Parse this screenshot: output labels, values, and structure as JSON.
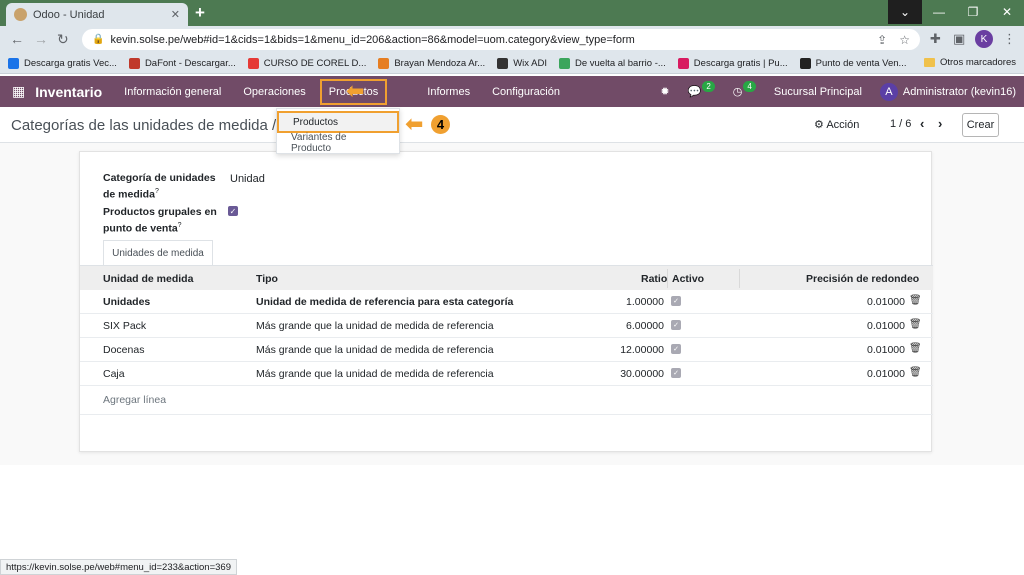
{
  "browser": {
    "tab_title": "Odoo - Unidad",
    "url": "kevin.solse.pe/web#id=1&cids=1&bids=1&menu_id=206&action=86&model=uom.category&view_type=form",
    "profile_initial": "K",
    "bookmarks": [
      {
        "label": "Descarga gratis Vec...",
        "color": "#1a73e8"
      },
      {
        "label": "DaFont - Descargar...",
        "color": "#c0392b"
      },
      {
        "label": "CURSO DE COREL D...",
        "color": "#e53935"
      },
      {
        "label": "Brayan Mendoza Ar...",
        "color": "#e67e22"
      },
      {
        "label": "Wix ADI",
        "color": "#333333"
      },
      {
        "label": "De vuelta al barrio -...",
        "color": "#3ba55c"
      },
      {
        "label": "Descarga gratis | Pu...",
        "color": "#d81b60"
      },
      {
        "label": "Punto de venta Ven...",
        "color": "#222222"
      }
    ],
    "other_bookmarks": "Otros marcadores",
    "status_url": "https://kevin.solse.pe/web#menu_id=233&action=369"
  },
  "navbar": {
    "app_name": "Inventario",
    "menu": [
      "Información general",
      "Operaciones",
      "Productos",
      "Informes",
      "Configuración"
    ],
    "messages_count": "2",
    "activities_count": "4",
    "branch": "Sucursal Principal",
    "user_initial": "A",
    "user_name": "Administrator (kevin16)"
  },
  "control_panel": {
    "breadcrumb": "Categorías de las unidades de medida / Unidad",
    "action_label": "Acción",
    "pager": "1 / 6",
    "create_label": "Crear"
  },
  "dropdown": {
    "items": [
      "Productos",
      "Variantes de Producto"
    ]
  },
  "annotation": {
    "step_number": "4",
    "highlight_color": "#f0a030"
  },
  "form": {
    "category_label": "Categoría de unidades de medida",
    "category_value": "Unidad",
    "group_products_label": "Productos grupales en punto de venta",
    "group_products_checked": true,
    "tab_label": "Unidades de medida",
    "columns": [
      "Unidad de medida",
      "Tipo",
      "Ratio",
      "Activo",
      "Precisión de redondeo"
    ],
    "rows": [
      {
        "name": "Unidades",
        "type": "Unidad de medida de referencia para esta categoría",
        "ratio": "1.00000",
        "active": true,
        "rounding": "0.01000",
        "bold": true
      },
      {
        "name": "SIX Pack",
        "type": "Más grande que la unidad de medida de referencia",
        "ratio": "6.00000",
        "active": true,
        "rounding": "0.01000",
        "bold": false
      },
      {
        "name": "Docenas",
        "type": "Más grande que la unidad de medida de referencia",
        "ratio": "12.00000",
        "active": true,
        "rounding": "0.01000",
        "bold": false
      },
      {
        "name": "Caja",
        "type": "Más grande que la unidad de medida de referencia",
        "ratio": "30.00000",
        "active": true,
        "rounding": "0.01000",
        "bold": false
      }
    ],
    "add_line_label": "Agregar línea"
  },
  "colors": {
    "odoo_brand": "#714b67",
    "browser_frame": "#4d7a52"
  }
}
